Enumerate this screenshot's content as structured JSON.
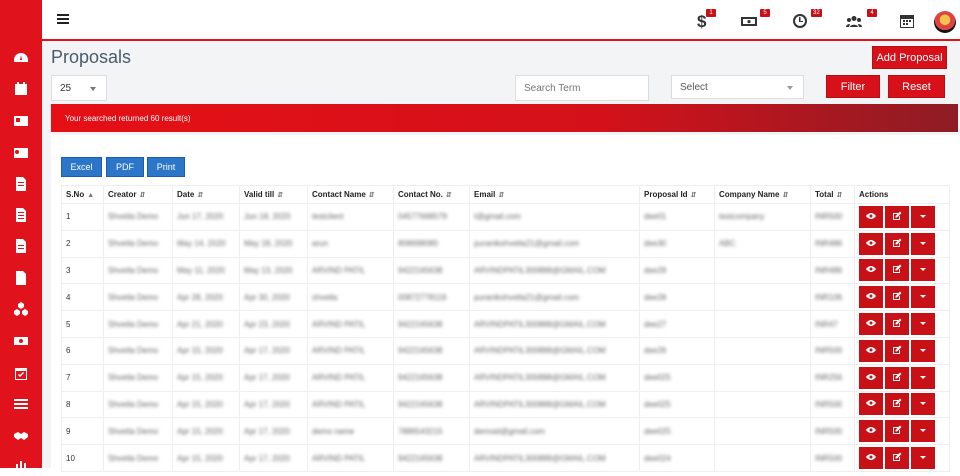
{
  "header": {
    "badges": {
      "dollar": "1",
      "cash": "5",
      "clock": "32",
      "people": "4"
    }
  },
  "page": {
    "title": "Proposals",
    "add_button": "Add Proposal",
    "per_page": "25",
    "search_placeholder": "Search Term",
    "select_label": "Select",
    "filter_button": "Filter",
    "reset_button": "Reset",
    "result_text": "Your searched returned 60 result(s)"
  },
  "exports": {
    "excel": "Excel",
    "pdf": "PDF",
    "print": "Print"
  },
  "table": {
    "headers": [
      "S.No",
      "Creator",
      "Date",
      "Valid till",
      "Contact Name",
      "Contact No.",
      "Email",
      "Proposal Id",
      "Company Name",
      "Total",
      "Actions"
    ],
    "rows": [
      {
        "sno": "1",
        "creator": "Shvetla Demo",
        "date": "Jun 17, 2020",
        "valid": "Jun 18, 2020",
        "contact": "testclient",
        "phone": "04577668579",
        "email": "t@gmail.com",
        "pid": "dee01",
        "company": "testcompany",
        "total": "INR500"
      },
      {
        "sno": "2",
        "creator": "Shvetla Demo",
        "date": "May 14, 2020",
        "valid": "May 18, 2020",
        "contact": "arun",
        "phone": "808698080",
        "email": "puranikshvetla21@gmail.com",
        "pid": "dee30",
        "company": "ABC",
        "total": "INR486"
      },
      {
        "sno": "3",
        "creator": "Shvetla Demo",
        "date": "May 11, 2020",
        "valid": "May 13, 2020",
        "contact": "ARVIND PATIL",
        "phone": "9422165638",
        "email": "ARVINDPATIL300888@GMAIL.COM",
        "pid": "dee29",
        "company": "",
        "total": "INR486"
      },
      {
        "sno": "4",
        "creator": "Shvetla Demo",
        "date": "Apr 28, 2020",
        "valid": "Apr 30, 2020",
        "contact": "shvetla",
        "phone": "00872778119",
        "email": "puranikshvetla21@gmail.com",
        "pid": "dee28",
        "company": "",
        "total": "INR106"
      },
      {
        "sno": "5",
        "creator": "Shvetla Demo",
        "date": "Apr 21, 2020",
        "valid": "Apr 23, 2020",
        "contact": "ARVIND PATIL",
        "phone": "9422165638",
        "email": "ARVINDPATIL300888@GMAIL.COM",
        "pid": "dee27",
        "company": "",
        "total": "INR47"
      },
      {
        "sno": "6",
        "creator": "Shvetla Demo",
        "date": "Apr 15, 2020",
        "valid": "Apr 17, 2020",
        "contact": "ARVIND PATIL",
        "phone": "9422165638",
        "email": "ARVINDPATIL300888@GMAIL.COM",
        "pid": "dee26",
        "company": "",
        "total": "INR500"
      },
      {
        "sno": "7",
        "creator": "Shvetla Demo",
        "date": "Apr 15, 2020",
        "valid": "Apr 17, 2020",
        "contact": "ARVIND PATIL",
        "phone": "9422165638",
        "email": "ARVINDPATIL300888@GMAIL.COM",
        "pid": "dee025",
        "company": "",
        "total": "INR256"
      },
      {
        "sno": "8",
        "creator": "Shvetla Demo",
        "date": "Apr 15, 2020",
        "valid": "Apr 17, 2020",
        "contact": "ARVIND PATIL",
        "phone": "9422165638",
        "email": "ARVINDPATIL300888@GMAIL.COM",
        "pid": "dee025",
        "company": "",
        "total": "INR500"
      },
      {
        "sno": "9",
        "creator": "Shvetla Demo",
        "date": "Apr 15, 2020",
        "valid": "Apr 17, 2020",
        "contact": "demo name",
        "phone": "7886543215",
        "email": "demoid@gmail.com",
        "pid": "dee025",
        "company": "",
        "total": "INR500"
      },
      {
        "sno": "10",
        "creator": "Shvetla Demo",
        "date": "Apr 15, 2020",
        "valid": "Apr 17, 2020",
        "contact": "ARVIND PATIL",
        "phone": "9422165638",
        "email": "ARVINDPATIL300888@GMAIL.COM",
        "pid": "dee024",
        "company": "",
        "total": "INR500"
      }
    ]
  },
  "colors": {
    "accent": "#e0121b",
    "export_blue": "#2b76c8",
    "title": "#4a5b6c"
  }
}
